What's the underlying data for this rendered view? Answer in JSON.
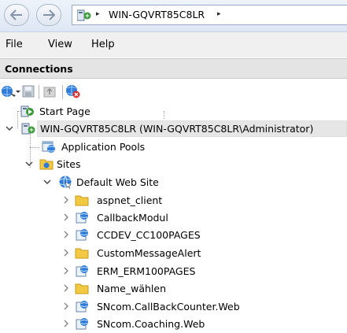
{
  "address_bar": {
    "breadcrumb": "WIN-GQVRT85C8LR",
    "separator": "▸"
  },
  "menu": {
    "items": [
      "File",
      "View",
      "Help"
    ]
  },
  "connections": {
    "title": "Connections"
  },
  "toolbar": {
    "icons": [
      "connect-icon",
      "save-icon",
      "up-icon",
      "disconnect-icon"
    ]
  },
  "tree": {
    "start_page": "Start Page",
    "server": "WIN-GQVRT85C8LR (WIN-GQVRT85C8LR\\Administrator)",
    "app_pools": "Application Pools",
    "sites": "Sites",
    "default_site": "Default Web Site",
    "children": [
      {
        "label": "aspnet_client",
        "icon": "folder-icon"
      },
      {
        "label": "CallbackModul",
        "icon": "web-app-icon"
      },
      {
        "label": "CCDEV_CC100PAGES",
        "icon": "web-app-icon"
      },
      {
        "label": "CustomMessageAlert",
        "icon": "folder-icon"
      },
      {
        "label": "ERM_ERM100PAGES",
        "icon": "web-app-icon"
      },
      {
        "label": "Name_wählen",
        "icon": "folder-icon"
      },
      {
        "label": "SNcom.CallBackCounter.Web",
        "icon": "web-app-icon"
      },
      {
        "label": "SNcom.Coaching.Web",
        "icon": "web-app-icon"
      }
    ]
  },
  "colors": {
    "selection": "#e6e6e6",
    "header_bg": "#e4e4e4",
    "menubar_bg": "#f0f0f0",
    "folder": "#f3c843",
    "globe": "#2f7bd6"
  }
}
